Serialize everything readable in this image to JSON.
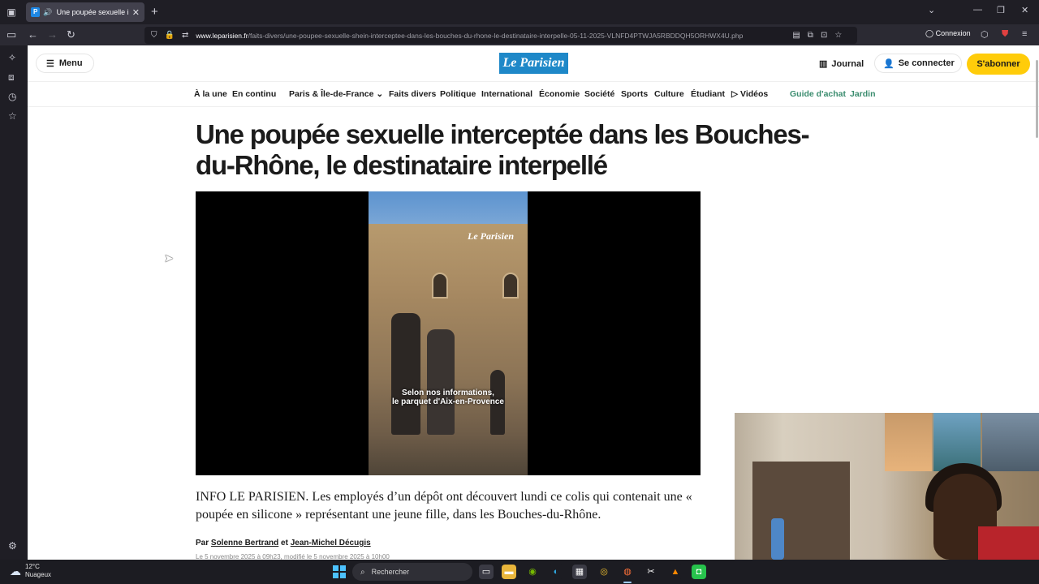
{
  "browser": {
    "tab_title": "Une poupée sexuelle intercep",
    "url_host": "www.leparisien.fr",
    "url_path": "/faits-divers/une-poupee-sexuelle-shein-interceptee-dans-les-bouches-du-rhone-le-destinataire-interpelle-05-11-2025-VLNFD4PTWJA5RBDDQH5ORHWX4U.php",
    "connexion_label": "Connexion",
    "extension_badge": "48"
  },
  "site": {
    "menu_label": "Menu",
    "logo_text": "Le Parisien",
    "journal_label": "Journal",
    "login_label": "Se connecter",
    "subscribe_label": "S'abonner",
    "nav": [
      "À la une",
      "En continu",
      "Paris & Île-de-France",
      "Faits divers",
      "Politique",
      "International",
      "Économie",
      "Société",
      "Sports",
      "Culture",
      "Étudiant",
      "Vidéos",
      "Guide d'achat",
      "Jardin"
    ]
  },
  "article": {
    "headline": "Une poupée sexuelle interceptée dans les Bouches-du-Rhône, le destinataire interpellé",
    "video_watermark": "Le Parisien",
    "video_caption_line1": "Selon nos informations,",
    "video_caption_line2": "le parquet d'Aix-en-Provence",
    "lede": "INFO LE PARISIEN. Les employés d’un dépôt ont découvert lundi ce colis qui contenait une « poupée en silicone » représentant une jeune fille, dans les Bouches-du-Rhône.",
    "byline_prefix": "Par",
    "author1": "Solenne Bertrand",
    "byline_and": "et",
    "author2": "Jean-Michel Décugis",
    "dateline": "Le 5 novembre 2025 à 09h23, modifié le 5 novembre 2025 à 10h00"
  },
  "taskbar": {
    "temperature": "12°C",
    "weather": "Nuageux",
    "search_placeholder": "Rechercher"
  },
  "colors": {
    "brand_blue": "#1e88c8",
    "subscribe_yellow": "#ffcc0a",
    "nav_green": "#3a8c6e"
  }
}
